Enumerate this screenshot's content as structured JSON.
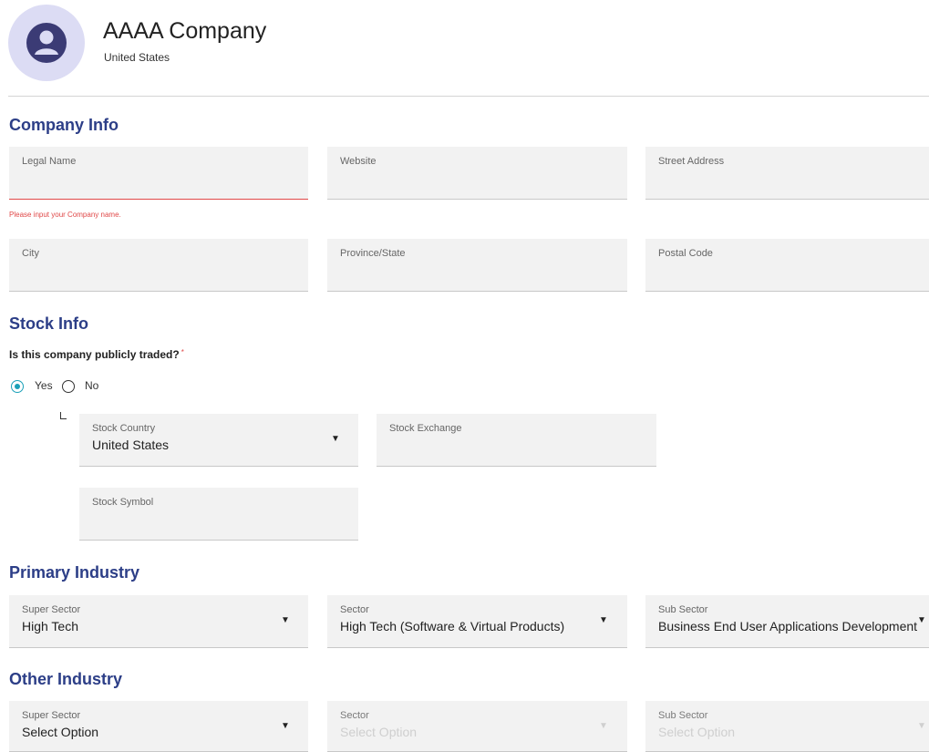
{
  "header": {
    "company_name": "AAAA Company",
    "country": "United States",
    "avatar_icon": "user-avatar-icon",
    "avatar_bg": "#dcdcf4",
    "avatar_fg": "#3b3b75"
  },
  "company_info": {
    "title": "Company Info",
    "legal_name_label": "Legal Name",
    "legal_name_error": "Please input your Company name.",
    "website_label": "Website",
    "street_address_label": "Street Address",
    "city_label": "City",
    "province_label": "Province/State",
    "postal_code_label": "Postal Code"
  },
  "stock_info": {
    "title": "Stock Info",
    "question": "Is this company publicly traded?",
    "required_mark": "*",
    "yes_label": "Yes",
    "no_label": "No",
    "selected": "Yes",
    "stock_country_label": "Stock Country",
    "stock_country_value": "United States",
    "stock_exchange_label": "Stock Exchange",
    "stock_symbol_label": "Stock Symbol"
  },
  "primary_industry": {
    "title": "Primary Industry",
    "super_sector_label": "Super Sector",
    "super_sector_value": "High Tech",
    "sector_label": "Sector",
    "sector_value": "High Tech (Software & Virtual Products)",
    "sub_sector_label": "Sub Sector",
    "sub_sector_value": "Business End User Applications Development"
  },
  "other_industry": {
    "title": "Other Industry",
    "super_sector_label": "Super Sector",
    "super_sector_value": "Select Option",
    "sector_label": "Sector",
    "sector_value": "Select Option",
    "sub_sector_label": "Sub Sector",
    "sub_sector_value": "Select Option"
  },
  "colors": {
    "section_title": "#2c3e87",
    "error": "#e04848",
    "radio_checked": "#1aa0b8",
    "field_bg": "#f2f2f2"
  },
  "icons": {
    "dropdown": "caret-down-icon"
  }
}
